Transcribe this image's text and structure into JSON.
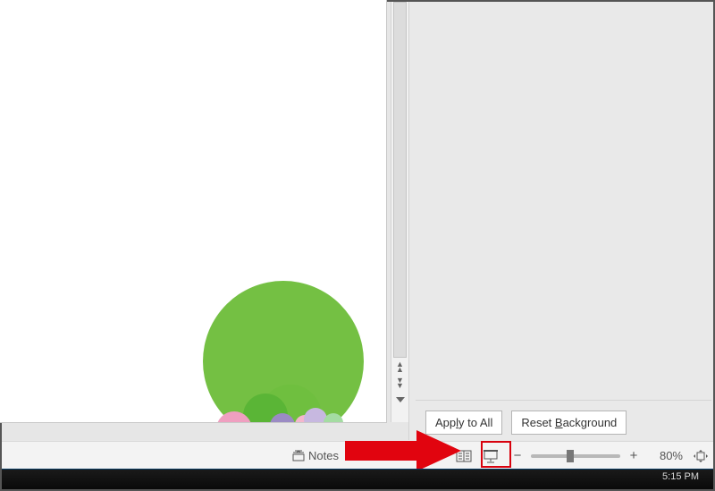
{
  "sidepanel": {
    "apply_all_label": "Apply to All",
    "apply_all_underline": "l",
    "reset_bg_label": "Reset Background",
    "reset_bg_underline": "B"
  },
  "statusbar": {
    "notes_label": "Notes",
    "zoom_percent": "80%"
  },
  "taskbar": {
    "time": "5:15 PM"
  }
}
